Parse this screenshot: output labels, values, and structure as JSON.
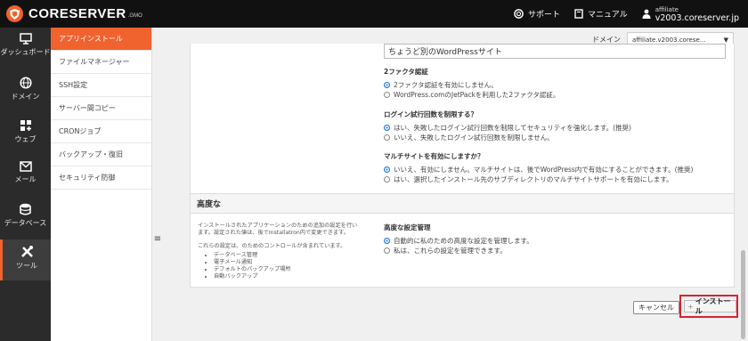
{
  "brand": {
    "name": "CORESERVER",
    "sub": ".GMO",
    "accent": "#f0622e"
  },
  "topbar": {
    "support": "サポート",
    "manual": "マニュアル",
    "account_label": "affiliate",
    "account_host": "v2003.coreserver.jp"
  },
  "iconbar": [
    {
      "label": "ダッシュボード",
      "icon": "monitor-icon"
    },
    {
      "label": "ドメイン",
      "icon": "globe-icon"
    },
    {
      "label": "ウェブ",
      "icon": "grid-plus-icon"
    },
    {
      "label": "メール",
      "icon": "envelope-icon"
    },
    {
      "label": "データベース",
      "icon": "database-icon"
    },
    {
      "label": "ツール",
      "icon": "tools-icon"
    }
  ],
  "submenu": [
    "アプリインストール",
    "ファイルマネージャー",
    "SSH設定",
    "サーバー間コピー",
    "CRONジョブ",
    "バックアップ・復旧",
    "セキュリティ防御"
  ],
  "domain": {
    "label": "ドメイン",
    "value": "affiliate.v2003.corese..."
  },
  "site_name_value": "ちょうど別のWordPressサイト",
  "two_factor": {
    "title": "2ファクタ認証",
    "options": [
      "2ファクタ認証を有効にしません。",
      "WordPress.comのJetPackを利用した2ファクタ認証。"
    ],
    "selected": 0
  },
  "login_limit": {
    "title": "ログイン試行回数を制限する？",
    "options": [
      "はい、失敗したログイン試行回数を制限してセキュリティを強化します。(推奨)",
      "いいえ、失敗したログイン試行回数を制限しません。"
    ],
    "selected": 0
  },
  "multisite": {
    "title": "マルチサイトを有効にしますか？",
    "options": [
      "いいえ、有効にしません。マルチサイトは、後でWordPress内で有効にすることができます。(推奨)",
      "はい、選択したインストール先のサブディレクトリのマルチサイトサポートを有効にします。"
    ],
    "selected": 0
  },
  "advanced": {
    "title": "高度な",
    "desc1": "インストールされたアプリケーションのための追加の設定を行います。設定された値は、後でInstallatron内で変更できます。",
    "desc2": "これらの設定は、のためのコントロールが含まれています。",
    "bullets": [
      "データベース管理",
      "電子メール通知",
      "デフォルトのバックアップ場所",
      "自動バックアップ"
    ],
    "manage_title": "高度な設定管理",
    "options": [
      "自動的に私のための高度な設定を管理します。",
      "私は、これらの設定を管理できます。"
    ],
    "selected": 0
  },
  "buttons": {
    "cancel": "キャンセル",
    "install": "インストール",
    "install_prefix": "+"
  },
  "colors": {
    "radio_selected": "#1a6fd4",
    "highlight": "#d9232e"
  }
}
